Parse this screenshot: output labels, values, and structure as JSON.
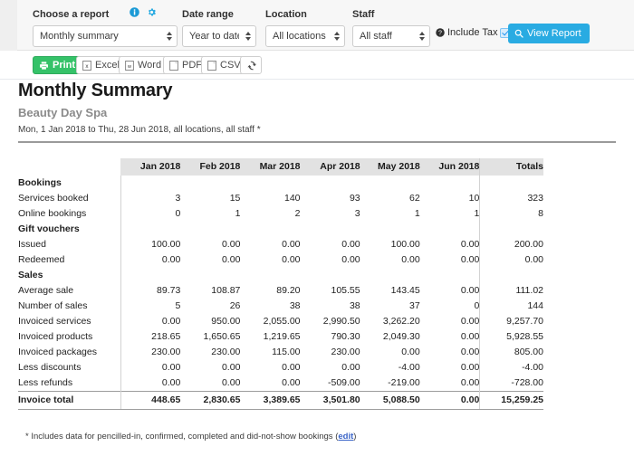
{
  "filters": {
    "report": {
      "label": "Choose a report",
      "value": "Monthly summary",
      "info_icon": "info-circle-icon",
      "settings_icon": "gear-icon"
    },
    "date_range": {
      "label": "Date range",
      "value": "Year to date (YTD)"
    },
    "location": {
      "label": "Location",
      "value": "All locations"
    },
    "staff": {
      "label": "Staff",
      "value": "All staff"
    },
    "include_tax": {
      "label": "Include Tax",
      "checked": true,
      "help_icon": "question-circle-icon"
    },
    "view_report": {
      "label": "View Report",
      "icon": "magnifier-icon",
      "color": "#29abe2"
    }
  },
  "toolbar": {
    "print": {
      "label": "Print",
      "icon": "printer-icon",
      "color": "#35c269"
    },
    "excel": {
      "label": "Excel",
      "icon": "excel-file-icon"
    },
    "word": {
      "label": "Word",
      "icon": "word-file-icon"
    },
    "pdf": {
      "label": "PDF",
      "icon": "pdf-file-icon"
    },
    "csv": {
      "label": "CSV",
      "icon": "csv-file-icon"
    },
    "refresh": {
      "icon": "refresh-icon"
    }
  },
  "report": {
    "title": "Monthly Summary",
    "business": "Beauty Day Spa",
    "range_text": "Mon, 1 Jan 2018 to Thu, 28 Jun 2018, all locations, all staff *"
  },
  "table": {
    "columns": [
      "",
      "Jan 2018",
      "Feb 2018",
      "Mar 2018",
      "Apr 2018",
      "May 2018",
      "Jun 2018",
      "Totals"
    ],
    "rows": [
      {
        "type": "section",
        "label": "Bookings",
        "values": [
          "",
          "",
          "",
          "",
          "",
          "",
          ""
        ]
      },
      {
        "type": "data",
        "label": "Services booked",
        "values": [
          "3",
          "15",
          "140",
          "93",
          "62",
          "10",
          "323"
        ]
      },
      {
        "type": "data",
        "label": "Online bookings",
        "values": [
          "0",
          "1",
          "2",
          "3",
          "1",
          "1",
          "8"
        ]
      },
      {
        "type": "section",
        "label": "Gift vouchers",
        "values": [
          "",
          "",
          "",
          "",
          "",
          "",
          ""
        ]
      },
      {
        "type": "data",
        "label": "Issued",
        "values": [
          "100.00",
          "0.00",
          "0.00",
          "0.00",
          "100.00",
          "0.00",
          "200.00"
        ]
      },
      {
        "type": "data",
        "label": "Redeemed",
        "values": [
          "0.00",
          "0.00",
          "0.00",
          "0.00",
          "0.00",
          "0.00",
          "0.00"
        ]
      },
      {
        "type": "section",
        "label": "Sales",
        "values": [
          "",
          "",
          "",
          "",
          "",
          "",
          ""
        ]
      },
      {
        "type": "data",
        "label": "Average sale",
        "values": [
          "89.73",
          "108.87",
          "89.20",
          "105.55",
          "143.45",
          "0.00",
          "111.02"
        ]
      },
      {
        "type": "data",
        "label": "Number of sales",
        "values": [
          "5",
          "26",
          "38",
          "38",
          "37",
          "0",
          "144"
        ]
      },
      {
        "type": "data",
        "label": "Invoiced services",
        "values": [
          "0.00",
          "950.00",
          "2,055.00",
          "2,990.50",
          "3,262.20",
          "0.00",
          "9,257.70"
        ]
      },
      {
        "type": "data",
        "label": "Invoiced products",
        "values": [
          "218.65",
          "1,650.65",
          "1,219.65",
          "790.30",
          "2,049.30",
          "0.00",
          "5,928.55"
        ]
      },
      {
        "type": "data",
        "label": "Invoiced packages",
        "values": [
          "230.00",
          "230.00",
          "115.00",
          "230.00",
          "0.00",
          "0.00",
          "805.00"
        ]
      },
      {
        "type": "data",
        "label": "Less discounts",
        "values": [
          "0.00",
          "0.00",
          "0.00",
          "0.00",
          "-4.00",
          "0.00",
          "-4.00"
        ]
      },
      {
        "type": "data",
        "label": "Less refunds",
        "values": [
          "0.00",
          "0.00",
          "0.00",
          "-509.00",
          "-219.00",
          "0.00",
          "-728.00"
        ]
      },
      {
        "type": "total",
        "label": "Invoice total",
        "values": [
          "448.65",
          "2,830.65",
          "3,389.65",
          "3,501.80",
          "5,088.50",
          "0.00",
          "15,259.25"
        ]
      }
    ]
  },
  "footnote": {
    "text": "* Includes data for pencilled-in, confirmed, completed and did-not-show bookings (",
    "link": "edit",
    "tail": ")"
  }
}
